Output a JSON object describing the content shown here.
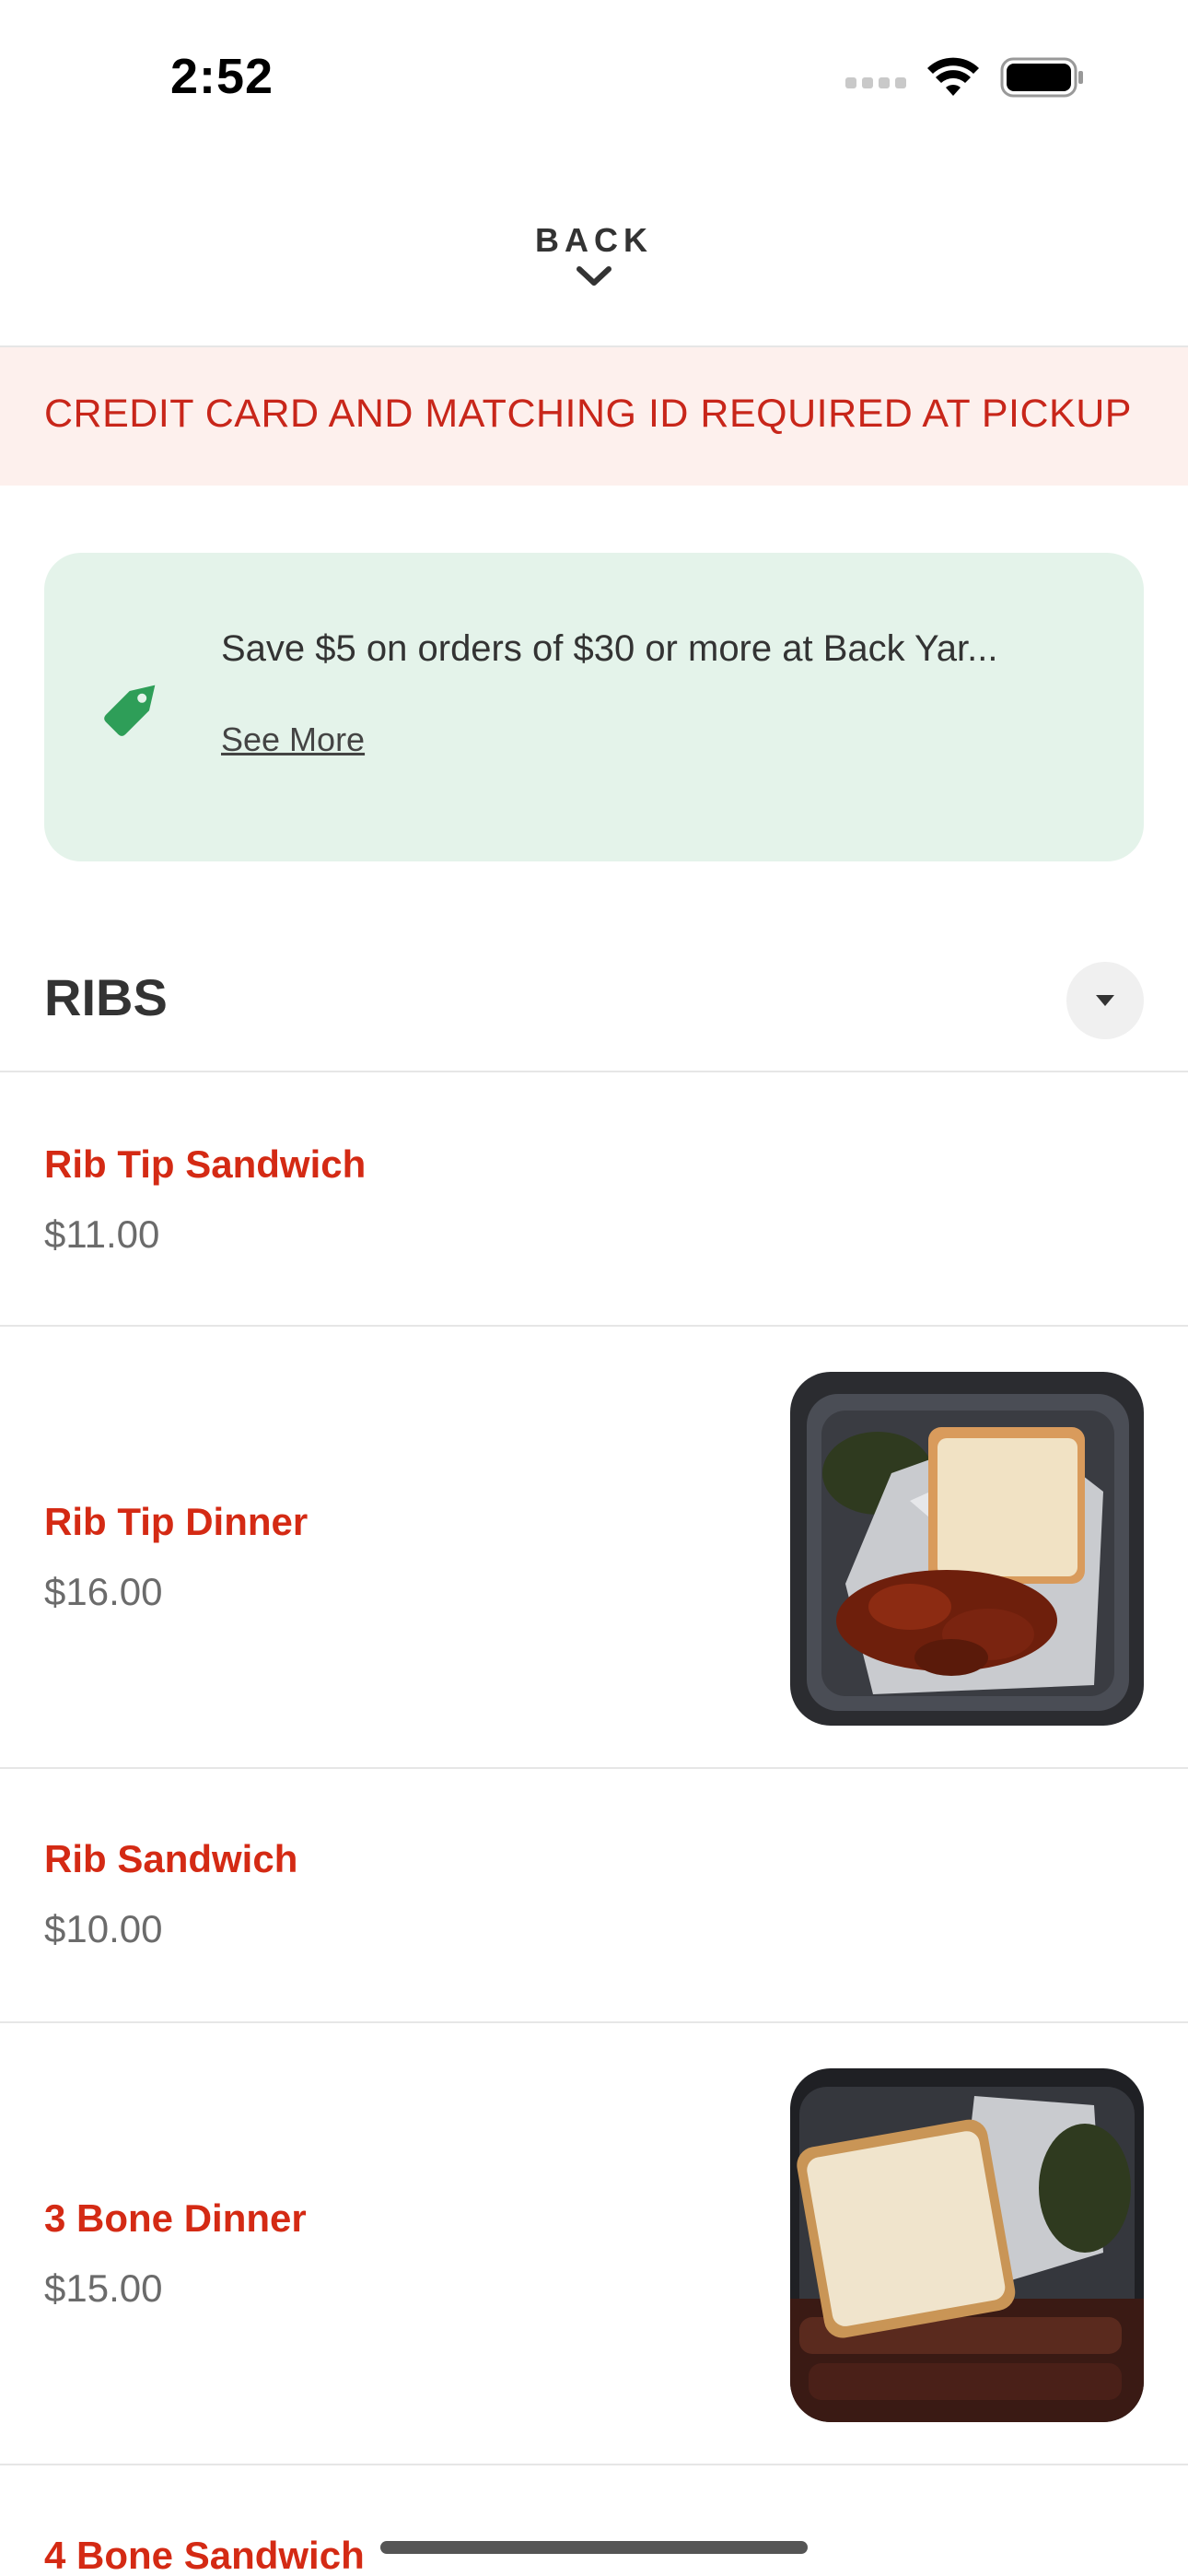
{
  "status_bar": {
    "time": "2:52"
  },
  "nav": {
    "back_label": "BACK"
  },
  "notice": {
    "text": "CREDIT CARD AND MATCHING ID REQUIRED AT PICKUP"
  },
  "promo": {
    "text": "Save $5 on orders of $30 or more at Back Yar...",
    "link_label": "See More",
    "icon": "price-tag-icon"
  },
  "section": {
    "title": "RIBS"
  },
  "menu_items": [
    {
      "name": "Rib Tip Sandwich",
      "price": "$11.00",
      "has_image": false
    },
    {
      "name": "Rib Tip Dinner",
      "price": "$16.00",
      "has_image": true
    },
    {
      "name": "Rib Sandwich",
      "price": "$10.00",
      "has_image": false
    },
    {
      "name": "3 Bone Dinner",
      "price": "$15.00",
      "has_image": true
    },
    {
      "name": "4 Bone Sandwich",
      "price": "",
      "has_image": false
    }
  ],
  "colors": {
    "accent_red": "#d42a14",
    "notice_bg": "#fdf0ed",
    "promo_bg": "#e4f3ea",
    "promo_icon": "#2e9e58"
  }
}
